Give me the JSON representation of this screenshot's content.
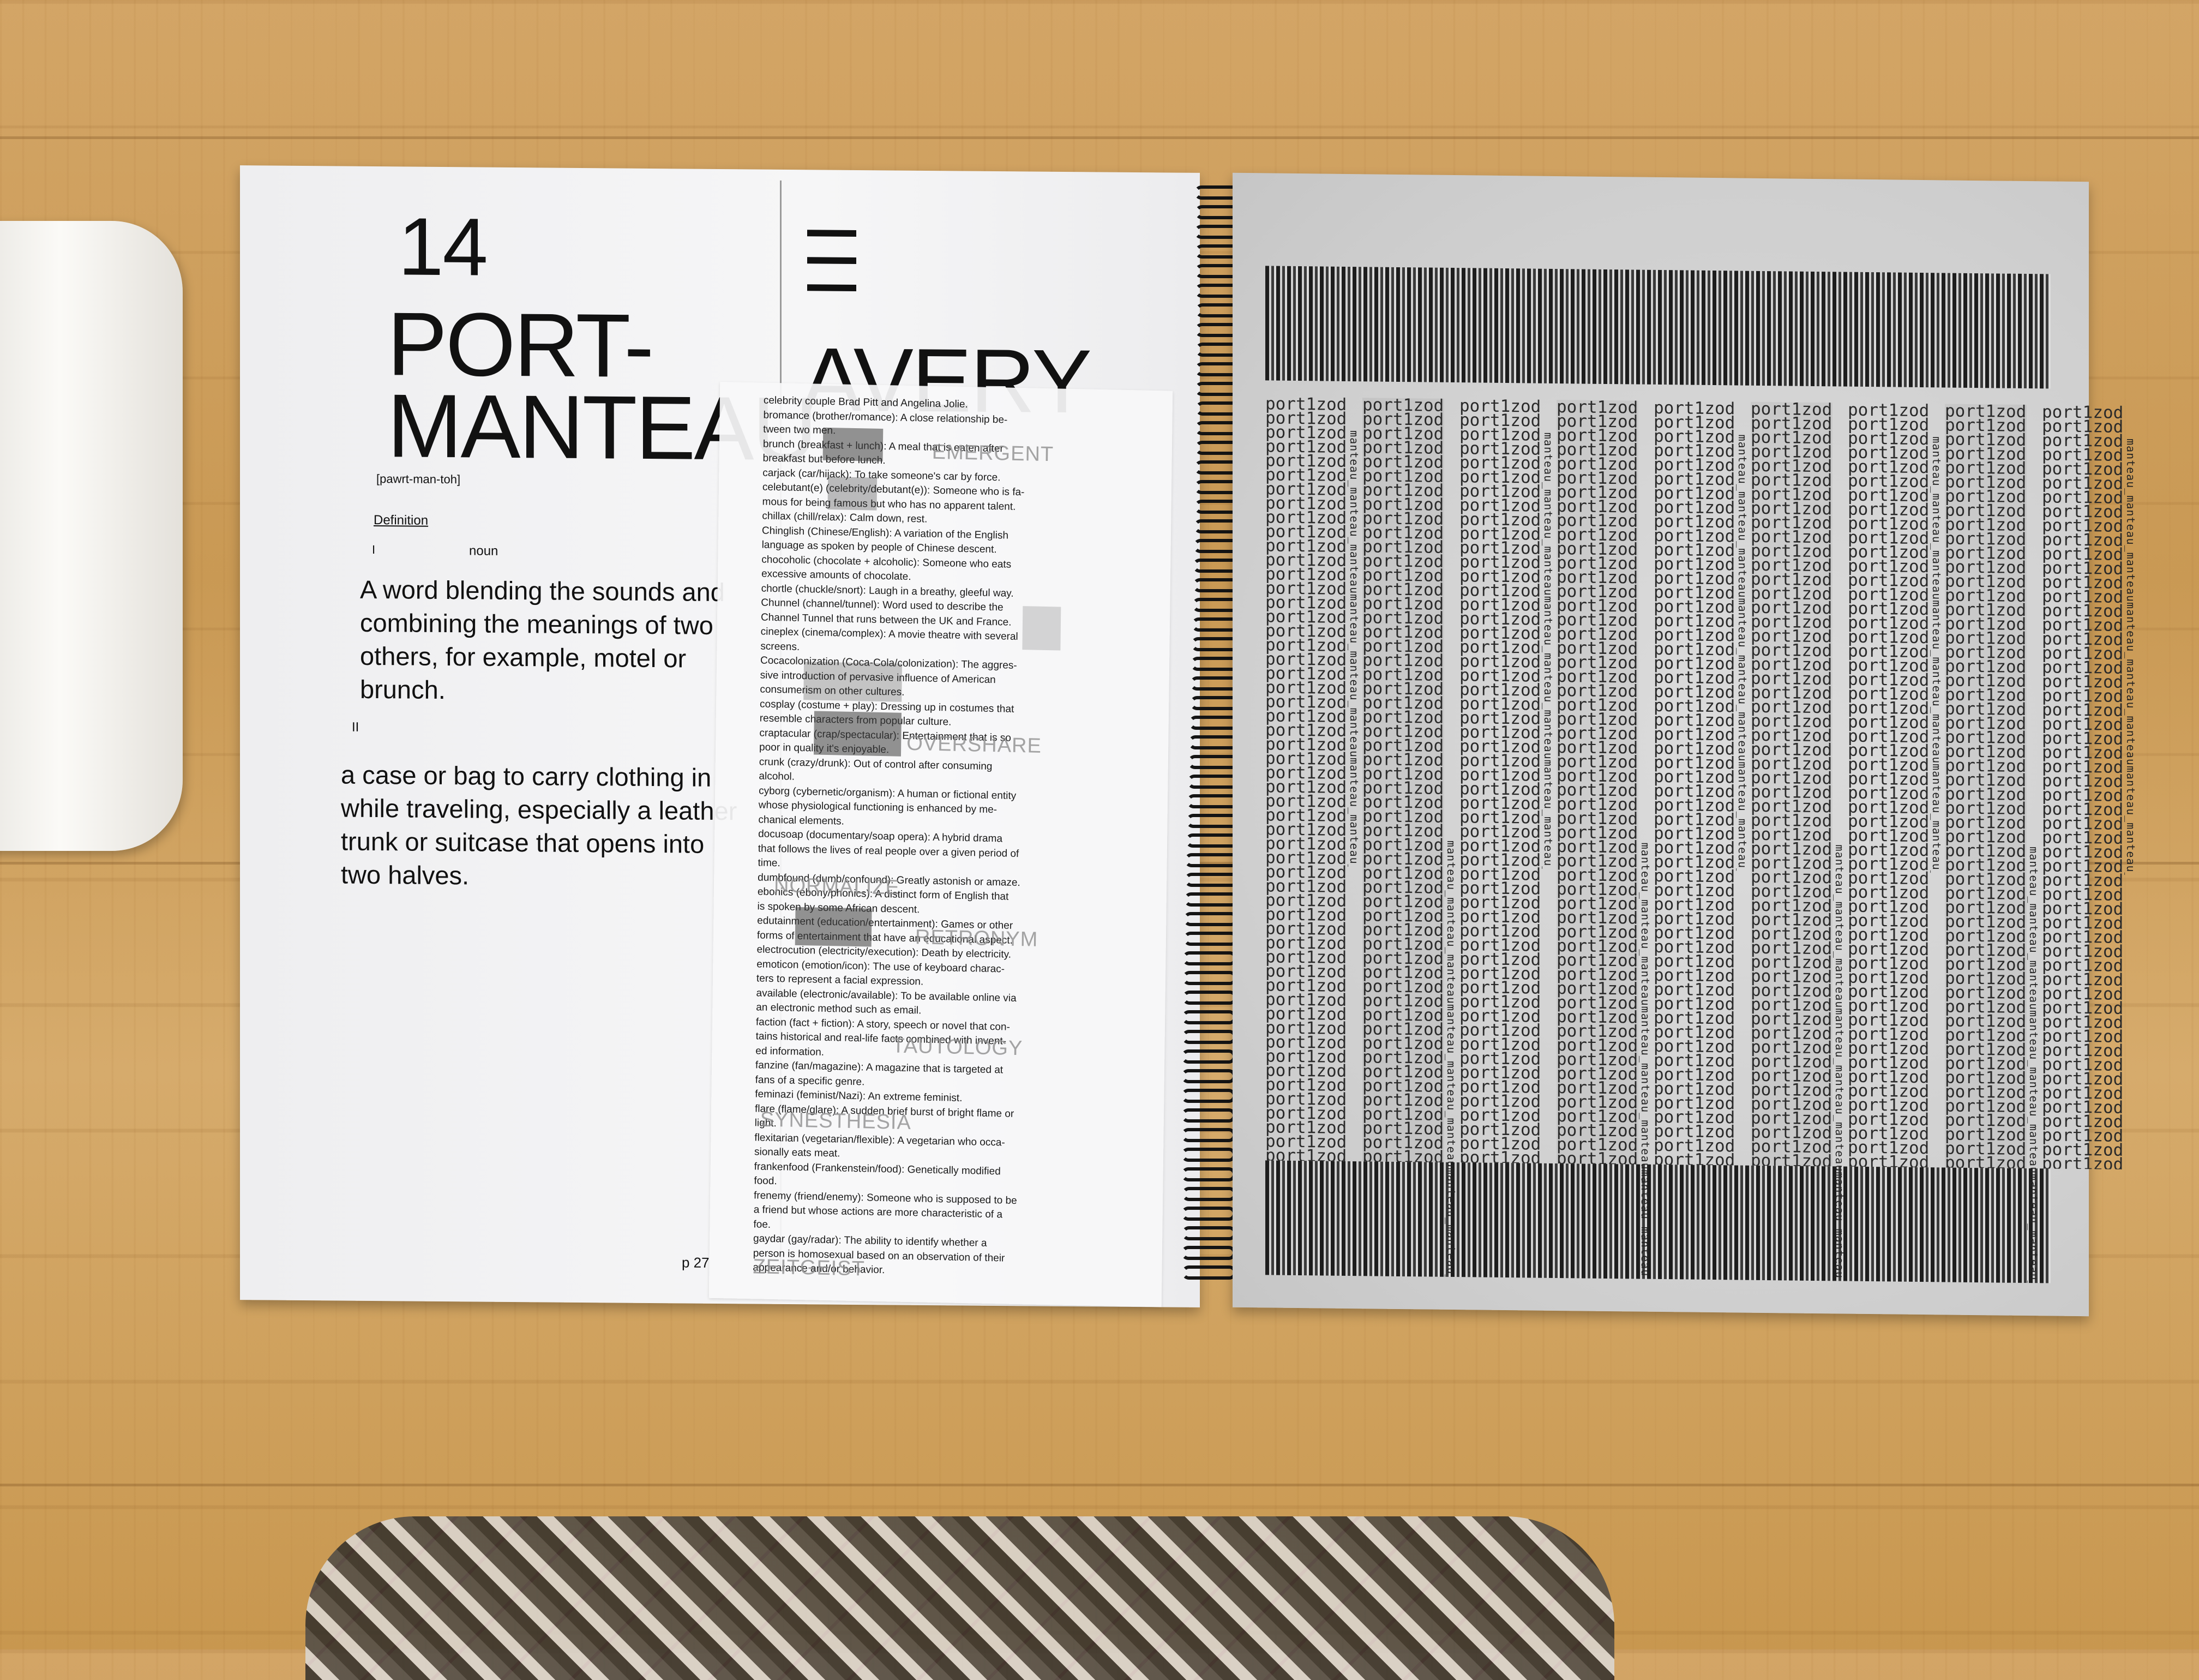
{
  "left_page": {
    "chapter_number": "14",
    "title": "PORT-\nMANTEAU",
    "pronunciation": "[pawrt-man-toh]",
    "definition_heading": "Definition",
    "sense_1": {
      "number": "I",
      "part_of_speech": "noun",
      "text": "A word blending the sounds and combining the meanings of two others, for example, motel or brunch."
    },
    "sense_2": {
      "number": "II",
      "text": "a case or bag to carry clothing in while traveling, especially a leather trunk or suitcase that opens into two halves."
    },
    "page_number": "p 27"
  },
  "second_column": {
    "big_word": "AVERY",
    "insert_entries": [
      "celebrity couple Brad Pitt and Angelina Jolie.",
      "bromance (brother/romance): A close relationship be-",
      "tween two men.",
      "brunch (breakfast + lunch): A meal that is eaten after",
      "breakfast but before lunch.",
      "carjack (car/hijack): To take someone's car by force.",
      "celebutant(e) (celebrity/debutant(e)): Someone who is fa-",
      "mous for being famous but who has no apparent talent.",
      "chillax (chill/relax): Calm down, rest.",
      "Chinglish (Chinese/English): A variation of the English",
      "language as spoken by people of Chinese descent.",
      "chocoholic (chocolate + alcoholic): Someone who eats",
      "excessive amounts of chocolate.",
      "chortle (chuckle/snort): Laugh in a breathy, gleeful way.",
      "Chunnel (channel/tunnel): Word used to describe the",
      "Channel Tunnel that runs between the UK and France.",
      "cineplex (cinema/complex): A movie theatre with several",
      "screens.",
      "Cocacolonization (Coca-Cola/colonization): The aggres-",
      "sive introduction of pervasive influence of American",
      "consumerism on other cultures.",
      "cosplay (costume + play): Dressing up in costumes that",
      "resemble characters from popular culture.",
      "craptacular (crap/spectacular): Entertainment that is so",
      "poor in quality it's enjoyable.",
      "crunk (crazy/drunk): Out of control after consuming",
      "alcohol.",
      "cyborg (cybernetic/organism): A human or fictional entity",
      "whose physiological functioning is enhanced by me-",
      "chanical elements.",
      "docusoap (documentary/soap opera): A hybrid drama",
      "that follows the lives of real people over a given period of",
      "time.",
      "dumbfound (dumb/confound): Greatly astonish or amaze.",
      "ebonics (ebony/phonics): A distinct form of English that",
      "is spoken by some African descent.",
      "edutainment (education/entertainment): Games or other",
      "forms of entertainment that have an educational aspect.",
      "electrocution (electricity/execution): Death by electricity.",
      "emoticon (emotion/icon): The use of keyboard charac-",
      "ters to represent a facial expression.",
      "available (electronic/available): To be available online via",
      "an electronic method such as email.",
      "faction (fact + fiction): A story, speech or novel that con-",
      "tains historical and real-life facts combined with invent-",
      "ed information.",
      "fanzine (fan/magazine): A magazine that is targeted at",
      "fans of a specific genre.",
      "feminazi (feminist/Nazi): An extreme feminist.",
      "flare (flame/glare): A sudden brief burst of bright flame or",
      "light.",
      "flexitarian (vegetarian/flexible): A vegetarian who occa-",
      "sionally eats meat.",
      "frankenfood (Frankenstein/food): Genetically modified",
      "food.",
      "frenemy (friend/enemy): Someone who is supposed to be",
      "a friend but whose actions are more characteristic of a",
      "foe.",
      "gaydar (gay/radar): The ability to identify whether a",
      "person is homosexual based on an observation of their",
      "appearance and/or behavior."
    ],
    "overlay_words": {
      "emergent": "EMERGENT",
      "overshare": "OVERSHARE",
      "normalize": "NORMALIZE",
      "retronym": "RETRONYM",
      "tautology": "TAUTOLOGY",
      "synesthesia": "SYNESTHESIA",
      "zeitgeist": "ZEITGEIST"
    }
  },
  "right_page": {
    "repeated_word": "port1zod",
    "vertical_text": "manteau_manteau_manteau"
  },
  "colors": {
    "desk": "#cf9f5f",
    "paper": "#f3f3f4",
    "ink": "#111111",
    "spiral": "#141414"
  }
}
